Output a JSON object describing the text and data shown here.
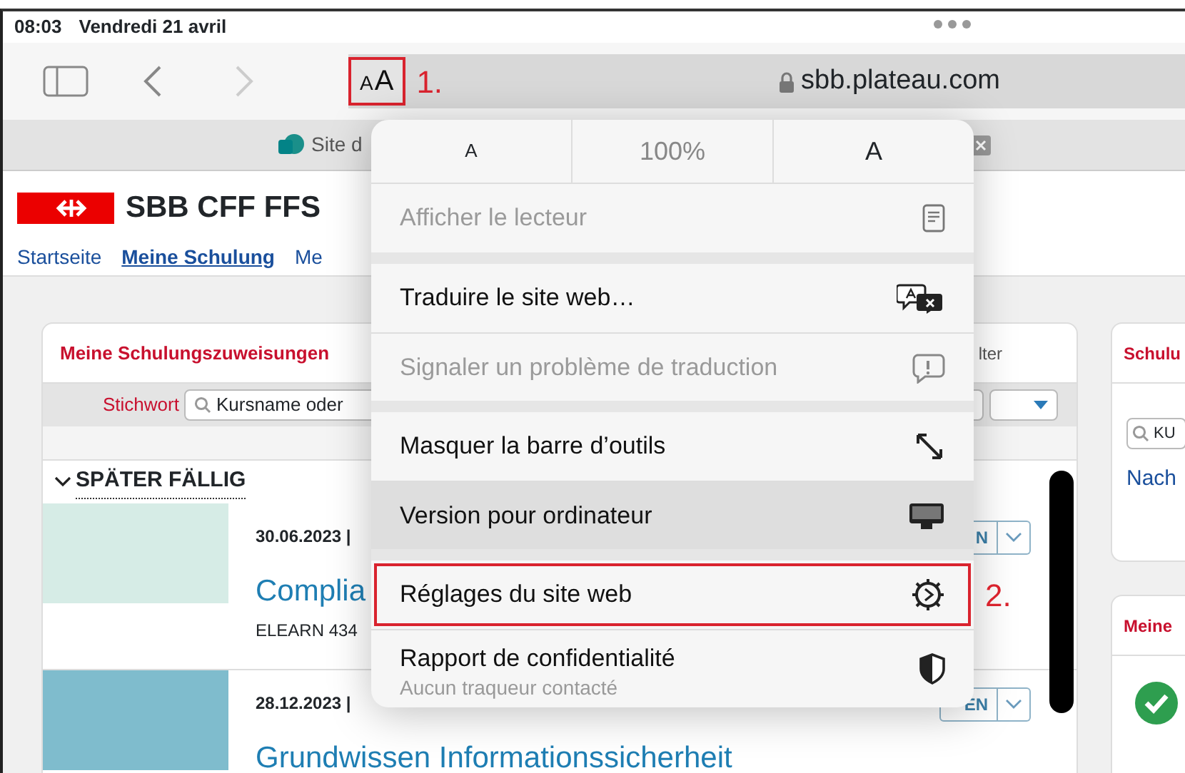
{
  "status_bar": {
    "time": "08:03",
    "date": "Vendredi 21 avril"
  },
  "toolbar": {
    "back_disabled": false,
    "forward_disabled": true,
    "format_button": {
      "small": "A",
      "large": "A",
      "annotation": "1."
    },
    "address": "sbb.plateau.com"
  },
  "tab": {
    "title": "Site d"
  },
  "page": {
    "brand": "SBB CFF FFS",
    "nav": [
      {
        "label": "Startseite",
        "selected": false
      },
      {
        "label": "Meine Schulung",
        "selected": true
      },
      {
        "label": "Me",
        "selected": false
      }
    ],
    "assignments": {
      "title": "Meine Schulungszuweisungen",
      "filter_label": "lter",
      "keyword_label": "Stichwort",
      "search_placeholder": "Kursname oder",
      "section": "SPÄTER FÄLLIG",
      "items": [
        {
          "date": "30.06.2023 |",
          "title": "Complia",
          "code": "ELEARN 434",
          "action": "N"
        },
        {
          "date": "28.12.2023 |",
          "title": "Grundwissen Informationssicherheit",
          "action": "EN"
        }
      ]
    },
    "side_cards": [
      {
        "kind": "search",
        "title": "Schulu",
        "search_placeholder": "KU",
        "link": "Nach"
      },
      {
        "kind": "status",
        "title": "Meine"
      }
    ]
  },
  "popover": {
    "text_size": {
      "smaller": "A",
      "zoom": "100%",
      "larger": "A"
    },
    "groups": [
      [
        {
          "label": "Afficher le lecteur",
          "disabled": true,
          "highlighted": false
        }
      ],
      [
        {
          "label": "Traduire le site web…",
          "disabled": false,
          "highlighted": false
        },
        {
          "label": "Signaler un problème de traduction",
          "disabled": true,
          "highlighted": false
        }
      ],
      [
        {
          "label": "Masquer la barre d’outils",
          "disabled": false,
          "highlighted": false
        },
        {
          "label": "Version pour ordinateur",
          "disabled": false,
          "highlighted": true
        }
      ],
      [
        {
          "label": "Réglages du site web",
          "disabled": false,
          "highlighted": false,
          "annotation": "2."
        },
        {
          "label": "Rapport de confidentialité",
          "subtitle": "Aucun traqueur contacté",
          "disabled": false,
          "highlighted": false
        }
      ]
    ]
  }
}
